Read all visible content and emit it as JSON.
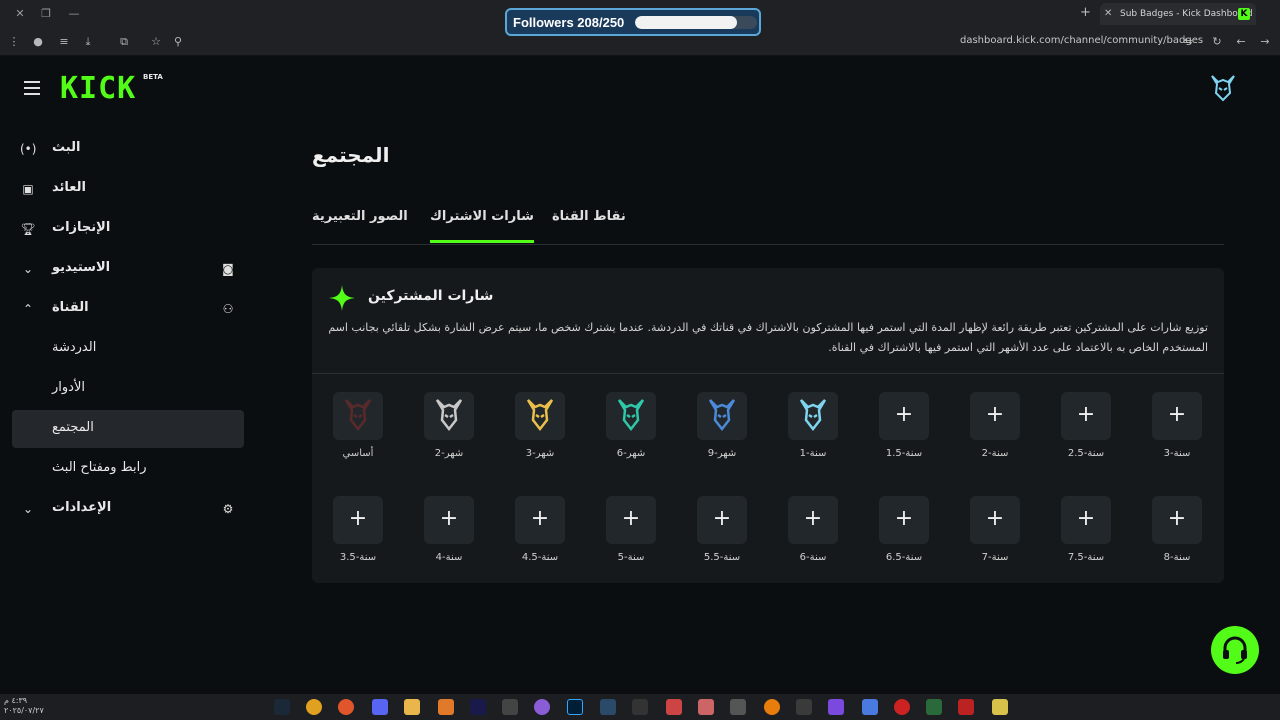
{
  "browser": {
    "tab_title": "Sub Badges - Kick Dashboard",
    "url": "dashboard.kick.com/channel/community/badges"
  },
  "overlay": {
    "followers_label": "Followers 208/250",
    "followers_progress": 0.832
  },
  "app": {
    "logo": "KICK",
    "beta": "BETA"
  },
  "sidebar": {
    "items": [
      {
        "label": "البث"
      },
      {
        "label": "العائد"
      },
      {
        "label": "الإنجازات"
      },
      {
        "label": "الاستيديو"
      },
      {
        "label": "القناة"
      },
      {
        "label": "الدردشة"
      },
      {
        "label": "الأدوار"
      },
      {
        "label": "المجتمع"
      },
      {
        "label": "رابط ومفتاح البث"
      },
      {
        "label": "الإعدادات"
      }
    ]
  },
  "main": {
    "title": "المجتمع",
    "tabs": [
      {
        "label": "الصور التعبيرية"
      },
      {
        "label": "شارات الاشتراك"
      },
      {
        "label": "نقاط القناة"
      }
    ],
    "card": {
      "title": "شارات المشتركين",
      "description": "توزيع شارات على المشتركين تعتبر طريقة رائعة لإظهار المدة التي استمر فيها المشتركون بالاشتراك في قناتك في الدردشة. عندما يشترك شخص ما، سيتم عرض الشارة بشكل تلقائي بجانب اسم المستخدم الخاص به بالاعتماد على عدد الأشهر التي استمر فيها بالاشتراك في القناة."
    },
    "badges_row1": [
      "أساسي",
      "شهر-2",
      "شهر-3",
      "شهر-6",
      "شهر-9",
      "سنة-1",
      "سنة-1.5",
      "سنة-2",
      "سنة-2.5",
      "سنة-3"
    ],
    "badges_row2": [
      "سنة-3.5",
      "سنة-4",
      "سنة-4.5",
      "سنة-5",
      "سنة-5.5",
      "سنة-6",
      "سنة-6.5",
      "سنة-7",
      "سنة-7.5",
      "سنة-8"
    ],
    "plus_symbol": "+"
  },
  "taskbar": {
    "time": "٤:٣٩ م",
    "date": "٢٠٢٥/٠٧/٢٧"
  },
  "colors": {
    "accent": "#53fc18",
    "background": "#0b0e10",
    "card": "#15191c"
  }
}
